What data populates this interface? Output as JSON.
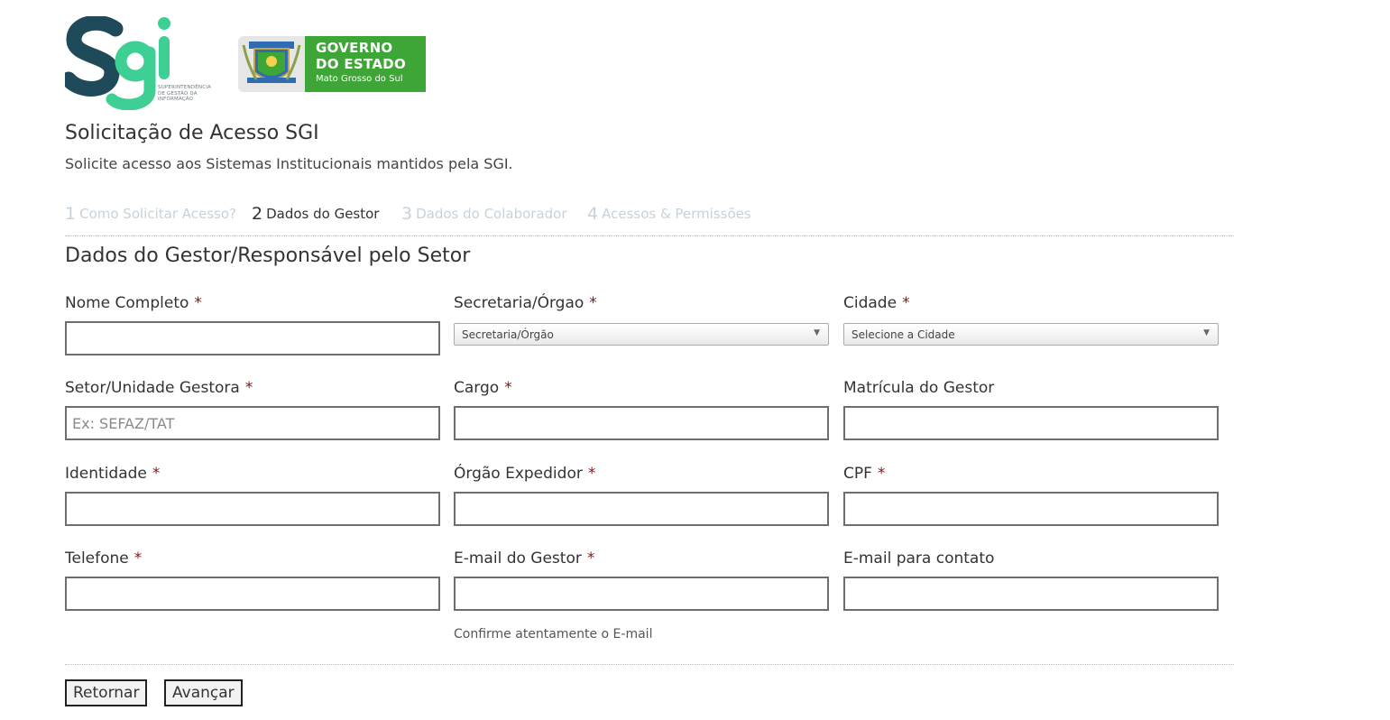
{
  "header": {
    "sgi_logo_text": "Sgi",
    "sgi_subtitle": "SUPERINTENDÊNCIA DE GESTÃO DA INFORMAÇÃO",
    "gov_line1": "GOVERNO",
    "gov_line2": "DO ESTADO",
    "gov_line3": "Mato Grosso do Sul"
  },
  "page": {
    "title": "Solicitação de Acesso SGI",
    "subtitle": "Solicite acesso aos Sistemas Institucionais mantidos pela SGI."
  },
  "steps": [
    {
      "num": "1",
      "label": "Como Solicitar Acesso?",
      "active": false
    },
    {
      "num": "2",
      "label": "Dados do Gestor",
      "active": true
    },
    {
      "num": "3",
      "label": "Dados do Colaborador",
      "active": false
    },
    {
      "num": "4",
      "label": "Acessos & Permissões",
      "active": false
    }
  ],
  "section_title": "Dados do Gestor/Responsável pelo Setor",
  "required_mark": "*",
  "fields": {
    "nome": {
      "label": "Nome Completo",
      "value": "",
      "placeholder": ""
    },
    "secretaria": {
      "label": "Secretaria/Órgao",
      "selected": "Secretaria/Órgão"
    },
    "cidade": {
      "label": "Cidade",
      "selected": "Selecione a Cidade"
    },
    "setor": {
      "label": "Setor/Unidade Gestora",
      "value": "",
      "placeholder": "Ex: SEFAZ/TAT"
    },
    "cargo": {
      "label": "Cargo",
      "value": "",
      "placeholder": ""
    },
    "matricula": {
      "label": "Matrícula do Gestor",
      "value": "",
      "placeholder": ""
    },
    "identidade": {
      "label": "Identidade",
      "value": "",
      "placeholder": ""
    },
    "orgao_expedidor": {
      "label": "Órgão Expedidor",
      "value": "",
      "placeholder": ""
    },
    "cpf": {
      "label": "CPF",
      "value": "",
      "placeholder": ""
    },
    "telefone": {
      "label": "Telefone",
      "value": "",
      "placeholder": ""
    },
    "email_gestor": {
      "label": "E-mail do Gestor",
      "value": "",
      "placeholder": "",
      "help": "Confirme atentamente o E-mail"
    },
    "email_contato": {
      "label": "E-mail para contato",
      "value": "",
      "placeholder": ""
    }
  },
  "buttons": {
    "back": "Retornar",
    "next": "Avançar"
  },
  "colors": {
    "sgi_dark": "#1f4a5a",
    "sgi_green": "#3ecf94",
    "gov_green": "#3da637",
    "required": "#7a1a1a",
    "step_inactive": "#c6d2da"
  }
}
